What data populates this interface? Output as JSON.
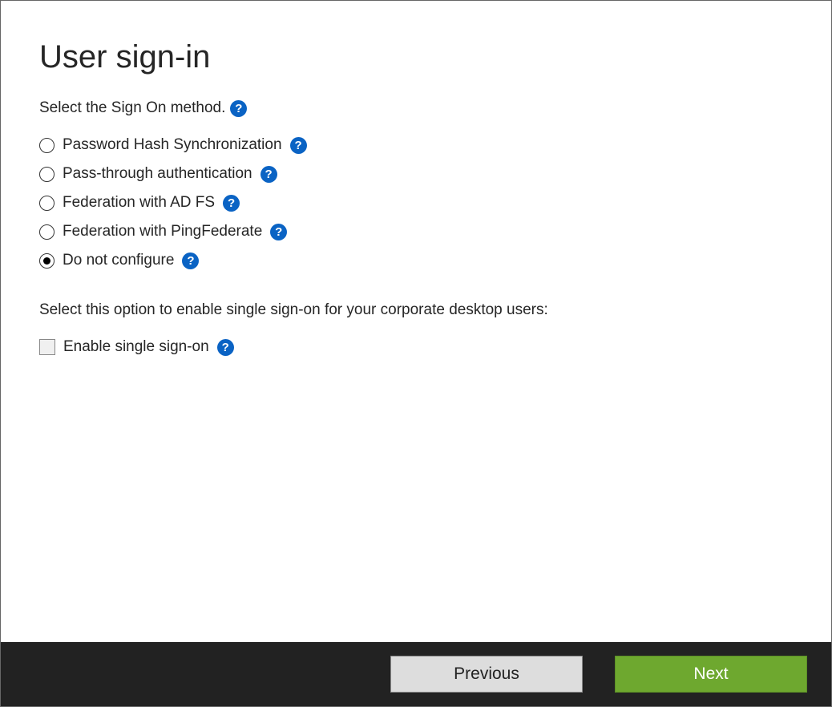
{
  "title": "User sign-in",
  "intro": "Select the Sign On method.",
  "options": [
    {
      "label": "Password Hash Synchronization",
      "selected": false
    },
    {
      "label": "Pass-through authentication",
      "selected": false
    },
    {
      "label": "Federation with AD FS",
      "selected": false
    },
    {
      "label": "Federation with PingFederate",
      "selected": false
    },
    {
      "label": "Do not configure",
      "selected": true
    }
  ],
  "sso_section_label": "Select this option to enable single sign-on for your corporate desktop users:",
  "sso_checkbox_label": "Enable single sign-on",
  "sso_checked": false,
  "help_glyph": "?",
  "buttons": {
    "previous": "Previous",
    "next": "Next"
  }
}
